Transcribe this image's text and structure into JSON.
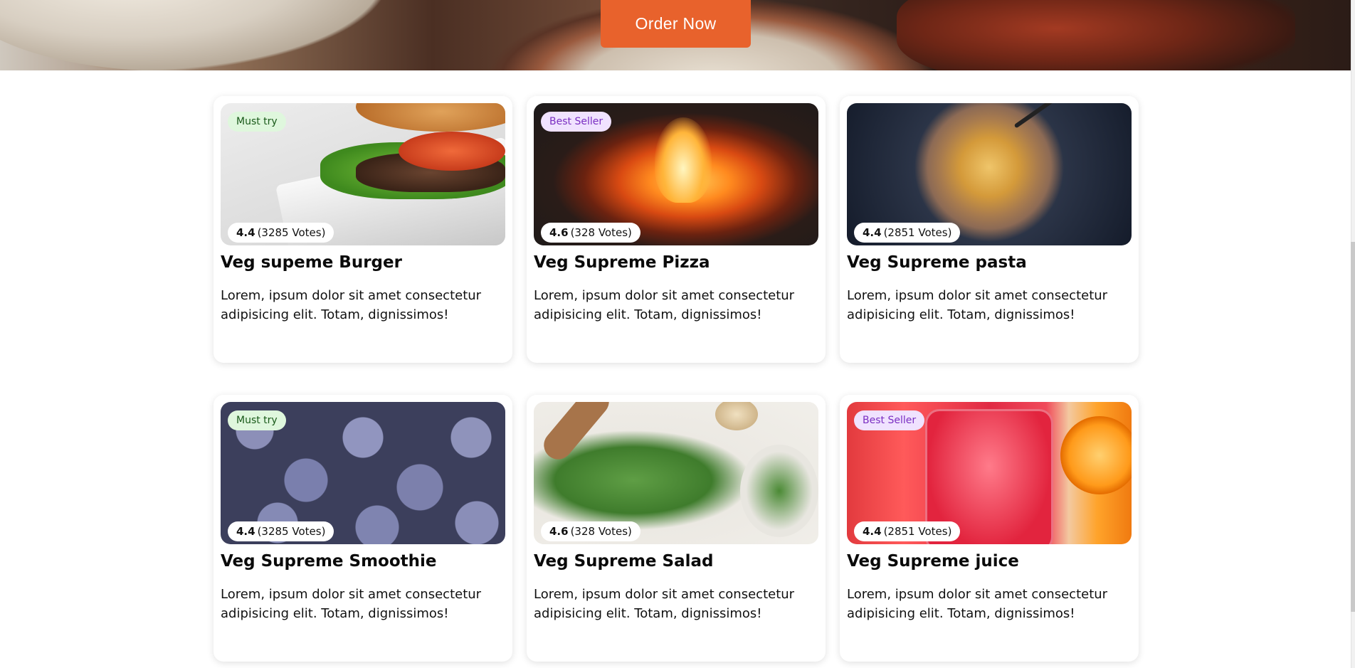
{
  "hero": {
    "order_button": "Order Now"
  },
  "colors": {
    "accent": "#e8622c",
    "must_try_bg": "#dff7dd",
    "best_seller_bg": "#f0e2ff"
  },
  "cards": [
    {
      "tag": "Must try",
      "rating_score": "4.4",
      "rating_votes": "(3285 Votes)",
      "title": "Veg supeme Burger",
      "description": "Lorem, ipsum dolor sit amet consectetur adipisicing elit. Totam, dignissimos!",
      "image": "burger"
    },
    {
      "tag": "Best Seller",
      "rating_score": "4.6",
      "rating_votes": "(328 Votes)",
      "title": "Veg Supreme Pizza",
      "description": "Lorem, ipsum dolor sit amet consectetur adipisicing elit. Totam, dignissimos!",
      "image": "pizza-oven"
    },
    {
      "tag": "",
      "rating_score": "4.4",
      "rating_votes": "(2851 Votes)",
      "title": "Veg Supreme pasta",
      "description": "Lorem, ipsum dolor sit amet consectetur adipisicing elit. Totam, dignissimos!",
      "image": "pasta"
    },
    {
      "tag": "Must try",
      "rating_score": "4.4",
      "rating_votes": "(3285 Votes)",
      "title": "Veg Supreme Smoothie",
      "description": "Lorem, ipsum dolor sit amet consectetur adipisicing elit. Totam, dignissimos!",
      "image": "blueberries"
    },
    {
      "tag": "",
      "rating_score": "4.6",
      "rating_votes": "(328 Votes)",
      "title": "Veg Supreme Salad",
      "description": "Lorem, ipsum dolor sit amet consectetur adipisicing elit. Totam, dignissimos!",
      "image": "salad"
    },
    {
      "tag": "Best Seller",
      "rating_score": "4.4",
      "rating_votes": "(2851 Votes)",
      "title": "Veg Supreme juice",
      "description": "Lorem, ipsum dolor sit amet consectetur adipisicing elit. Totam, dignissimos!",
      "image": "juice"
    }
  ]
}
